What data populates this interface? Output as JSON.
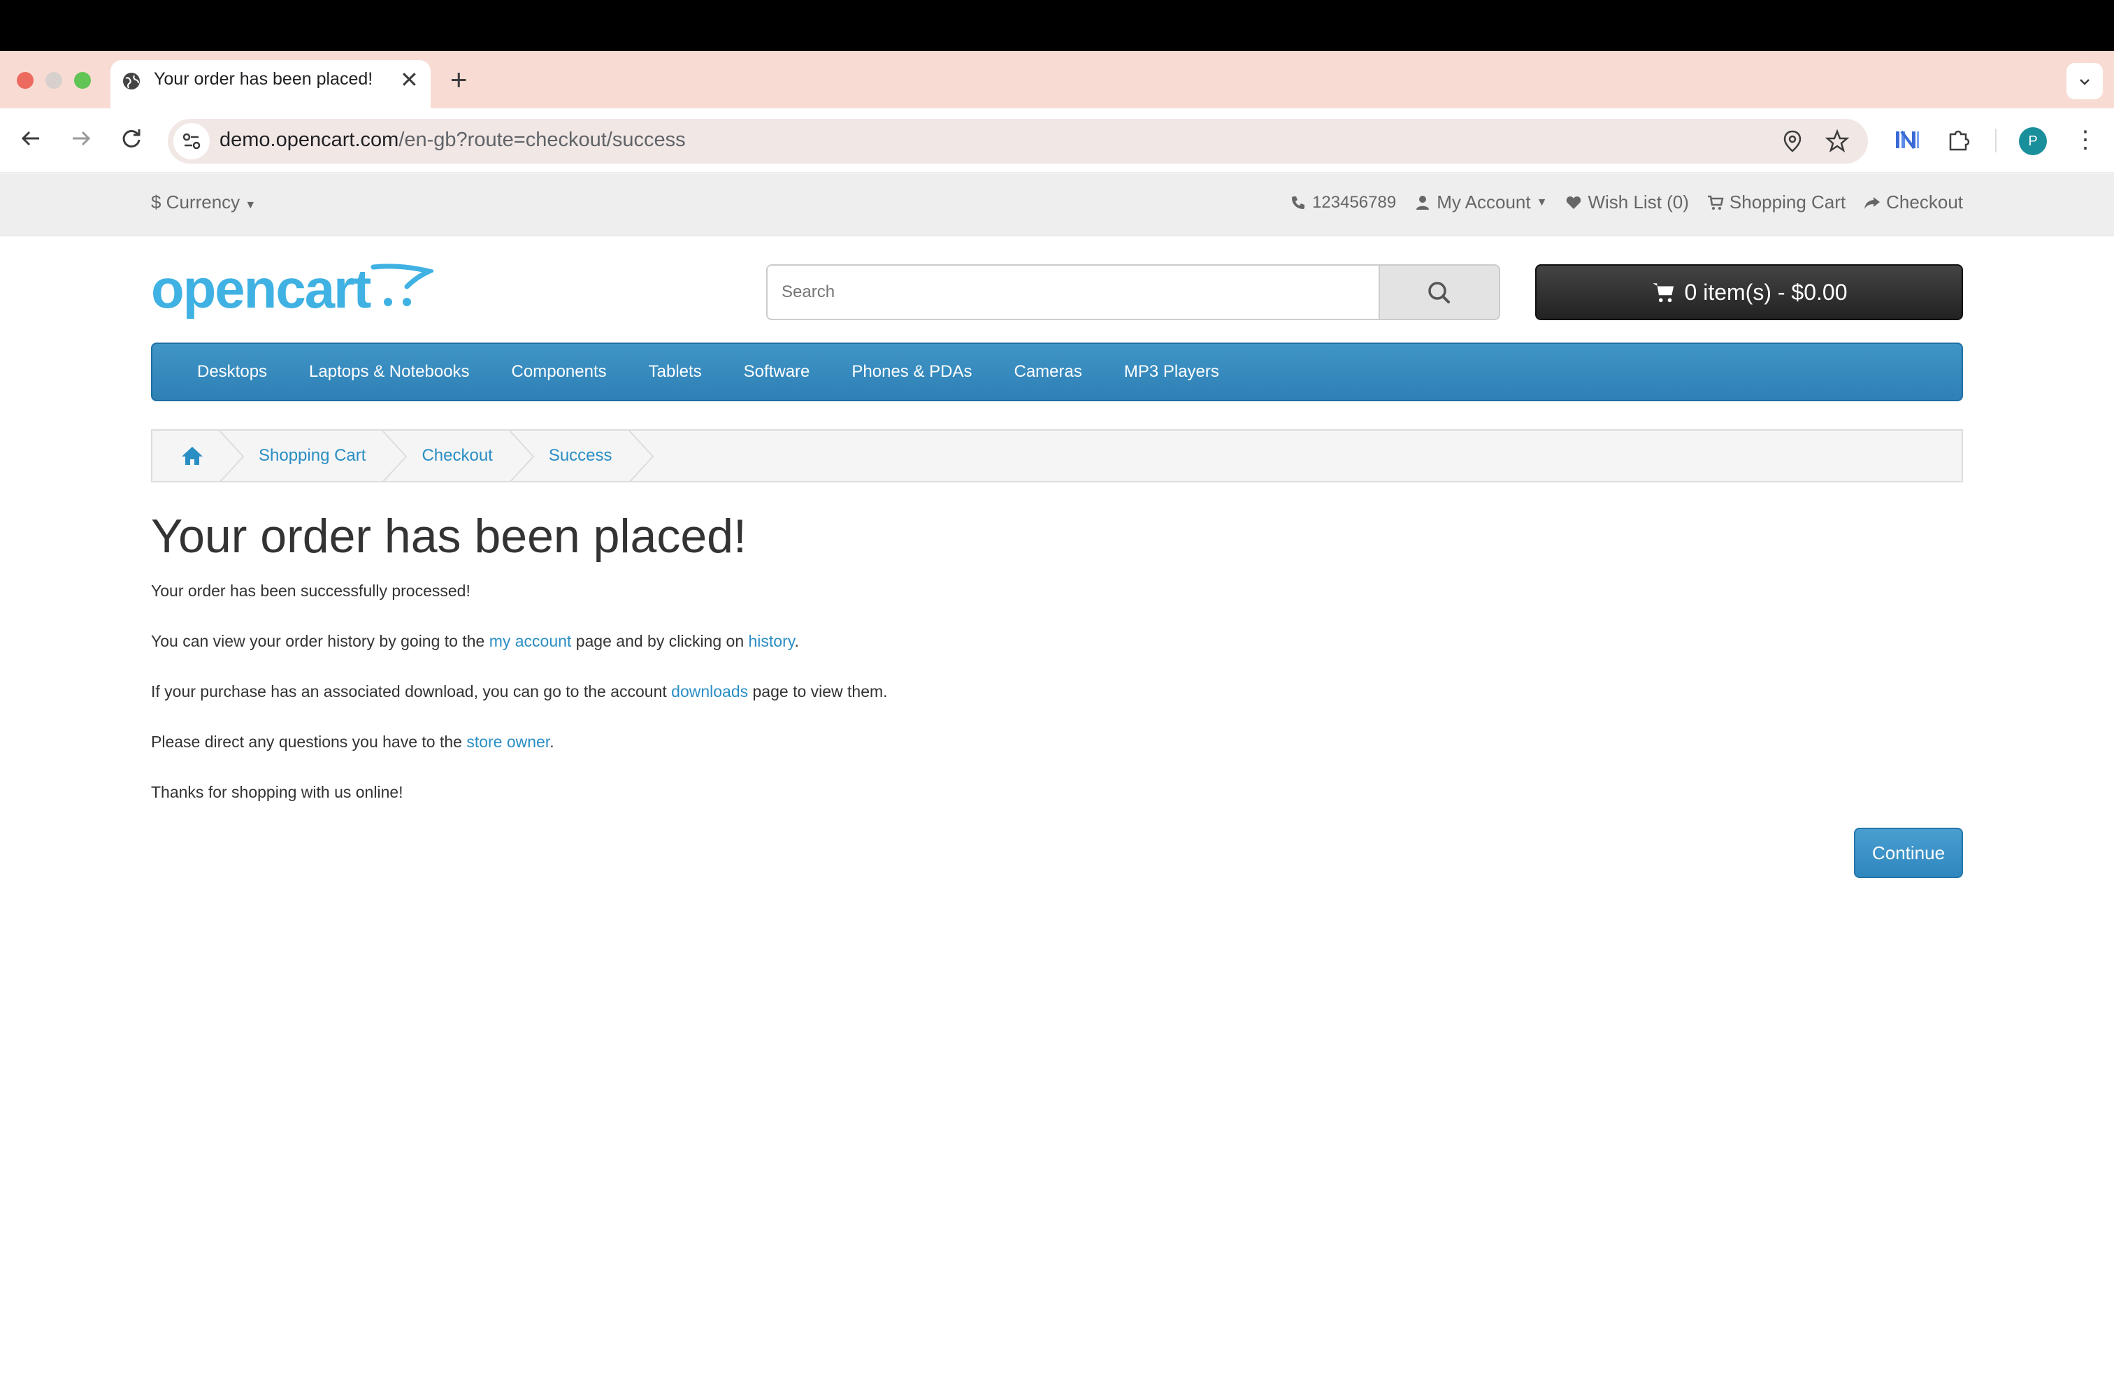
{
  "browser": {
    "tab_title": "Your order has been placed!",
    "tab_close": "✕",
    "new_tab": "+",
    "url_host": "demo.opencart.com",
    "url_path": "/en-gb?route=checkout/success",
    "profile_initial": "P",
    "tab_menu_icon": "chevron-down-icon"
  },
  "topbar": {
    "currency": "$ Currency",
    "phone": "123456789",
    "my_account": "My Account",
    "wish_list": "Wish List (0)",
    "shopping_cart": "Shopping Cart",
    "checkout": "Checkout"
  },
  "header": {
    "search_placeholder": "Search",
    "cart_label": "0 item(s) - $0.00"
  },
  "menu": {
    "items": [
      "Desktops",
      "Laptops & Notebooks",
      "Components",
      "Tablets",
      "Software",
      "Phones & PDAs",
      "Cameras",
      "MP3 Players"
    ]
  },
  "breadcrumb": {
    "items": [
      "Shopping Cart",
      "Checkout",
      "Success"
    ]
  },
  "content": {
    "title": "Your order has been placed!",
    "p1": "Your order has been successfully processed!",
    "p2_a": "You can view your order history by going to the ",
    "p2_link1": "my account",
    "p2_b": " page and by clicking on ",
    "p2_link2": "history",
    "p2_c": ".",
    "p3_a": "If your purchase has an associated download, you can go to the account ",
    "p3_link": "downloads",
    "p3_b": " page to view them.",
    "p4_a": "Please direct any questions you have to the ",
    "p4_link": "store owner",
    "p4_b": ".",
    "p5": "Thanks for shopping with us online!",
    "continue": "Continue"
  },
  "colors": {
    "link": "#2a8ec4",
    "menu": "#3a8cc1",
    "cart_button": "#333333"
  }
}
